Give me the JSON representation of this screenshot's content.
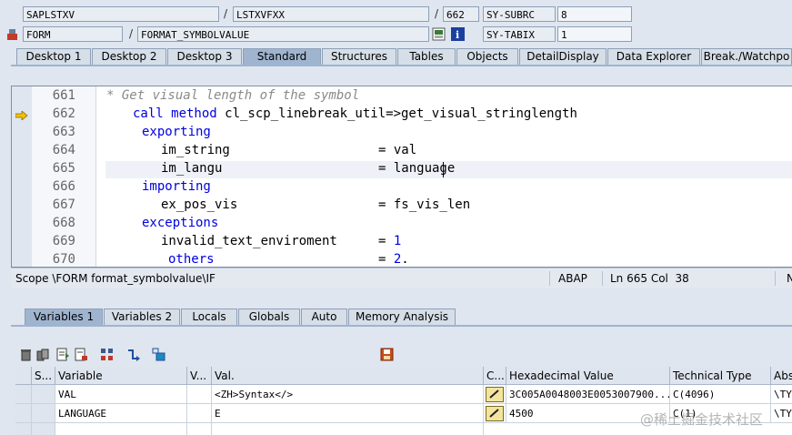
{
  "top": {
    "program": "SAPLSTXV",
    "include": "LSTXVFXX",
    "line": "662",
    "field1_name": "SY-SUBRC",
    "field1_value": "8",
    "event_type": "FORM",
    "event_name": "FORMAT_SYMBOLVALUE",
    "field2_name": "SY-TABIX",
    "field2_value": "1",
    "slash": "/"
  },
  "tabs": [
    "Desktop 1",
    "Desktop 2",
    "Desktop 3",
    "Standard",
    "Structures",
    "Tables",
    "Objects",
    "DetailDisplay",
    "Data Explorer",
    "Break./Watchpo"
  ],
  "active_tab": "Standard",
  "code": {
    "lines": [
      {
        "no": "661",
        "text": "* Get visual length of the symbol"
      },
      {
        "no": "662",
        "kw": "call method",
        "rest": " cl_scp_linebreak_util=>get_visual_stringlength"
      },
      {
        "no": "663",
        "kw": "exporting",
        "rest": ""
      },
      {
        "no": "664",
        "a": "im_string",
        "b": "= val"
      },
      {
        "no": "665",
        "a": "im_langu",
        "b": "= language"
      },
      {
        "no": "666",
        "kw": "importing",
        "rest": ""
      },
      {
        "no": "667",
        "a": "ex_pos_vis",
        "b": "= fs_vis_len"
      },
      {
        "no": "668",
        "kw": "exceptions",
        "rest": ""
      },
      {
        "no": "669",
        "a": "invalid_text_enviroment",
        "b": "= ",
        "n": "1"
      },
      {
        "no": "670",
        "kw": "others",
        "b": "= ",
        "n": "2",
        "tail": "."
      }
    ]
  },
  "status": {
    "scope": "Scope \\FORM format_symbolvalue\\IF",
    "lang": "ABAP",
    "pos": "Ln 665 Col  38",
    "edge": "N"
  },
  "bottom_tabs": [
    "Variables 1",
    "Variables 2",
    "Locals",
    "Globals",
    "Auto",
    "Memory Analysis"
  ],
  "grid": {
    "headers": [
      "S...",
      "Variable",
      "V...",
      "Val.",
      "C...",
      "Hexadecimal Value",
      "Technical Type",
      "Abs"
    ],
    "rows": [
      {
        "variable": "VAL",
        "val": "<ZH>Syntax</>",
        "hex": "3C005A0048003E0053007900...",
        "type": "C(4096)",
        "abs": "\\TY"
      },
      {
        "variable": "LANGUAGE",
        "val": "E",
        "hex": "4500",
        "type": "C(1)",
        "abs": "\\TY"
      }
    ]
  },
  "watermark": "@稀土掘金技术社区",
  "colors": {
    "accent": "#0000e0",
    "arrow": "#f2c200",
    "tab_active": "#9fb4cf"
  }
}
